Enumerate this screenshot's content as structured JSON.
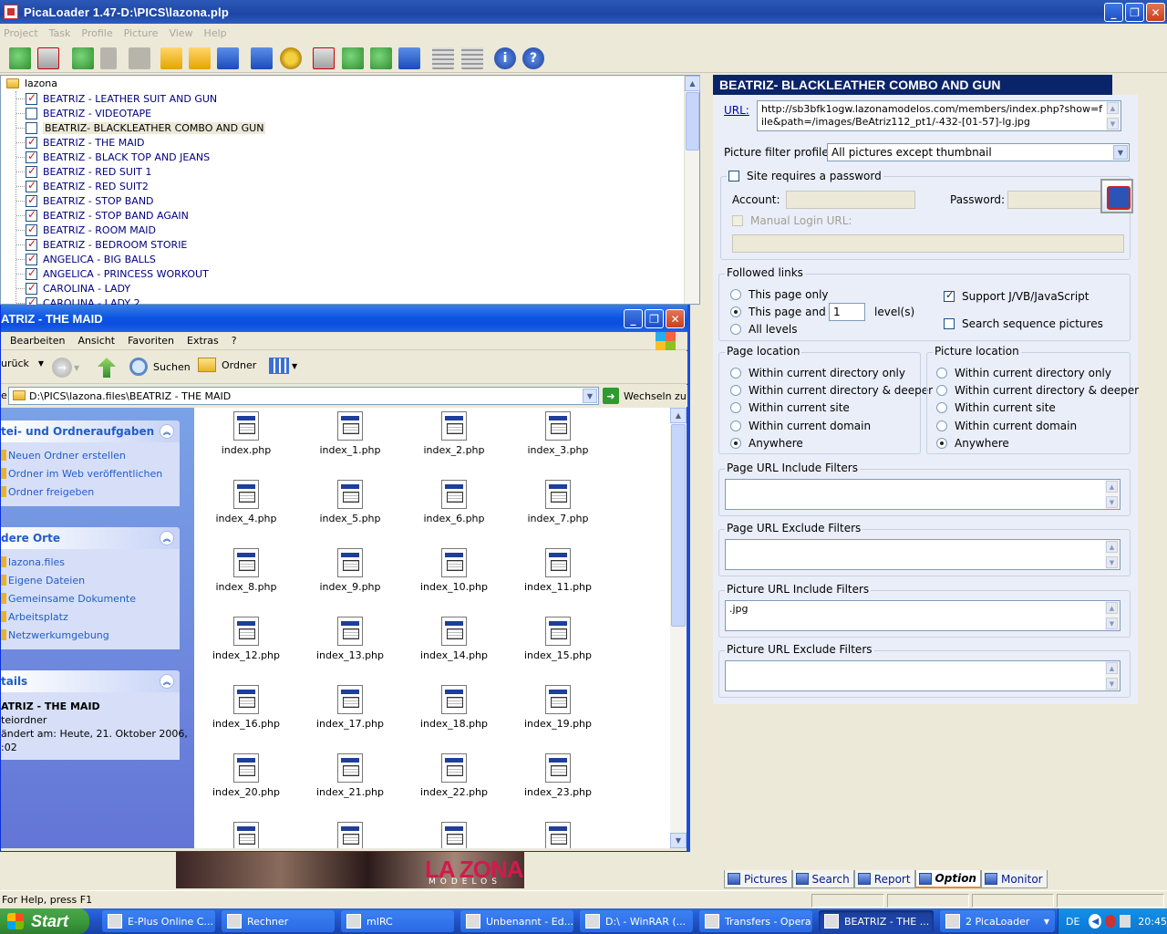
{
  "main_window": {
    "title": "PicaLoader 1.47-D:\\PICS\\lazona.plp",
    "menu": [
      "Project",
      "Task",
      "Profile",
      "Picture",
      "View",
      "Help"
    ]
  },
  "toolbar_icons": [
    "add-project-icon",
    "remove-project-icon",
    "start-icon",
    "pause-icon",
    "stop-icon",
    "open-folder-icon",
    "open-icon",
    "save-icon",
    "import-icon",
    "settings-icon",
    "delete-icon",
    "copy-icon",
    "move-icon",
    "export-icon",
    "grid-view-icon",
    "list-view-icon",
    "info-icon",
    "help-icon"
  ],
  "tree": {
    "root": "lazona",
    "items": [
      {
        "label": "BEATRIZ - LEATHER SUIT AND GUN",
        "checked": true
      },
      {
        "label": "BEATRIZ - VIDEOTAPE",
        "checked": false
      },
      {
        "label": "BEATRIZ- BLACKLEATHER COMBO AND GUN",
        "checked": false,
        "selected": true
      },
      {
        "label": "BEATRIZ - THE MAID",
        "checked": true
      },
      {
        "label": "BEATRIZ - BLACK TOP AND JEANS",
        "checked": true
      },
      {
        "label": "BEATRIZ - RED SUIT 1",
        "checked": true
      },
      {
        "label": "BEATRIZ - RED SUIT2",
        "checked": true
      },
      {
        "label": "BEATRIZ - STOP BAND",
        "checked": true
      },
      {
        "label": "BEATRIZ - STOP BAND AGAIN",
        "checked": true
      },
      {
        "label": "BEATRIZ - ROOM MAID",
        "checked": true
      },
      {
        "label": "BEATRIZ - BEDROOM STORIE",
        "checked": true
      },
      {
        "label": "ANGELICA - BIG BALLS",
        "checked": true
      },
      {
        "label": "ANGELICA - PRINCESS WORKOUT",
        "checked": true
      },
      {
        "label": "CAROLINA - LADY",
        "checked": true
      },
      {
        "label": "CAROLINA - LADY 2",
        "checked": true
      }
    ]
  },
  "options": {
    "header": "BEATRIZ- BLACKLEATHER COMBO AND GUN",
    "url_label": "URL:",
    "url_value": "http://sb3bfk1ogw.lazonamodelos.com/members/index.php?show=file&path=/images/BeAtriz112_pt1/-432-[01-57]-lg.jpg",
    "filter_profile_label": "Picture filter profile:",
    "filter_profile_value": "All pictures except thumbnail",
    "site_password_label": "Site requires a password",
    "account_label": "Account:",
    "password_label": "Password:",
    "manual_login_label": "Manual Login URL:",
    "followed_links": {
      "title": "Followed links",
      "this_page_only": "This page only",
      "this_page_and": "This page and",
      "levels_value": "1",
      "levels_label": "level(s)",
      "all_levels": "All levels",
      "support_js": "Support J/VB/JavaScript",
      "search_sequence": "Search sequence pictures"
    },
    "page_location": {
      "title": "Page location",
      "options": [
        "Within current directory only",
        "Within current directory & deeper",
        "Within current site",
        "Within current domain",
        "Anywhere"
      ]
    },
    "picture_location": {
      "title": "Picture location",
      "options": [
        "Within current directory only",
        "Within current directory & deeper",
        "Within current site",
        "Within current domain",
        "Anywhere"
      ]
    },
    "page_url_include": {
      "title": "Page URL Include Filters",
      "value": ""
    },
    "page_url_exclude": {
      "title": "Page URL Exclude Filters",
      "value": ""
    },
    "picture_url_include": {
      "title": "Picture URL Include Filters",
      "value": ".jpg"
    },
    "picture_url_exclude": {
      "title": "Picture URL Exclude Filters",
      "value": ""
    }
  },
  "bottom_tabs": [
    "Pictures",
    "Search",
    "Report",
    "Option",
    "Monitor"
  ],
  "status_text": "For Help, press F1",
  "explorer": {
    "title": "ATRIZ - THE MAID",
    "menu": [
      "Bearbeiten",
      "Ansicht",
      "Favoriten",
      "Extras",
      "?"
    ],
    "back_label": "urück",
    "search_label": "Suchen",
    "folders_label": "Ordner",
    "address": "D:\\PICS\\lazona.files\\BEATRIZ - THE MAID",
    "go_label": "Wechseln zu",
    "address_prefix": "e",
    "tasks_title": "tei- und Ordneraufgaben",
    "tasks": [
      "Neuen Ordner erstellen",
      "Ordner im Web veröffentlichen",
      "Ordner freigeben"
    ],
    "places_title": "dere Orte",
    "places": [
      "lazona.files",
      "Eigene Dateien",
      "Gemeinsame Dokumente",
      "Arbeitsplatz",
      "Netzwerkumgebung"
    ],
    "details_title": "tails",
    "details_name": "ATRIZ - THE MAID",
    "details_type": "teiordner",
    "details_changed": "ändert am: Heute, 21. Oktober 2006,",
    "details_time": ":02",
    "files": [
      "index.php",
      "index_1.php",
      "index_2.php",
      "index_3.php",
      "index_4.php",
      "index_5.php",
      "index_6.php",
      "index_7.php",
      "index_8.php",
      "index_9.php",
      "index_10.php",
      "index_11.php",
      "index_12.php",
      "index_13.php",
      "index_14.php",
      "index_15.php",
      "index_16.php",
      "index_17.php",
      "index_18.php",
      "index_19.php",
      "index_20.php",
      "index_21.php",
      "index_22.php",
      "index_23.php",
      "",
      "",
      "",
      ""
    ]
  },
  "background_logo": {
    "main": "LA ZONA",
    "sub": "MODELOS"
  },
  "taskbar": {
    "start": "Start",
    "tasks": [
      "E-Plus Online C...",
      "Rechner",
      "mIRC",
      "Unbenannt - Ed...",
      "D:\\ - WinRAR (...",
      "Transfers - Opera",
      "BEATRIZ - THE ...",
      "2 PicaLoader"
    ],
    "lang": "DE",
    "clock": "20:45"
  }
}
